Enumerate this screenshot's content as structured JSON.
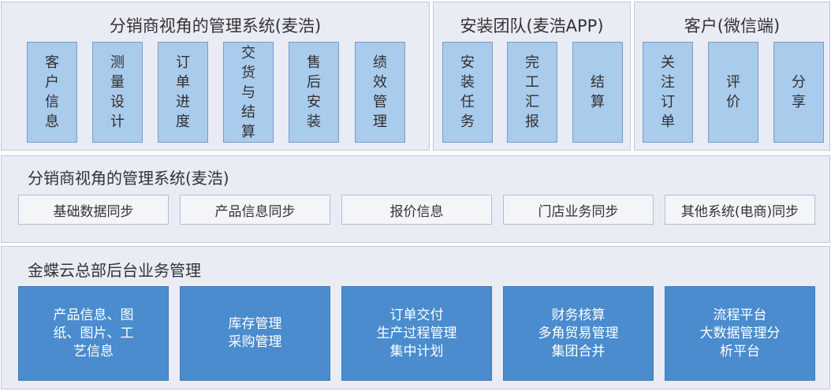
{
  "top_row": {
    "distributor": {
      "title": "分销商视角的管理系统(麦浩)",
      "items": [
        "客户信息",
        "测量设计",
        "订单进度",
        "交货与结算",
        "售后安装",
        "绩效管理"
      ]
    },
    "install_team": {
      "title": "安装团队(麦浩APP)",
      "items": [
        "安装任务",
        "完工汇报",
        "结算"
      ]
    },
    "customer": {
      "title": "客户(微信端)",
      "items": [
        "关注订单",
        "评价",
        "分享"
      ]
    }
  },
  "middle_row": {
    "title": "分销商视角的管理系统(麦浩)",
    "items": [
      "基础数据同步",
      "产品信息同步",
      "报价信息",
      "门店业务同步",
      "其他系统(电商)同步"
    ]
  },
  "bottom_row": {
    "title": "金蝶云总部后台业务管理",
    "items": [
      "产品信息、图\n纸、图片、工\n艺信息",
      "库存管理\n采购管理",
      "订单交付\n生产过程管理\n集中计划",
      "财务核算\n多角贸易管理\n集团合并",
      "流程平台\n大数据管理分\n析平台"
    ]
  },
  "colors": {
    "panel_bg": "#e9ecf5",
    "light_blue_box": "#a9cbec",
    "dark_blue_box": "#4a8ccd"
  }
}
